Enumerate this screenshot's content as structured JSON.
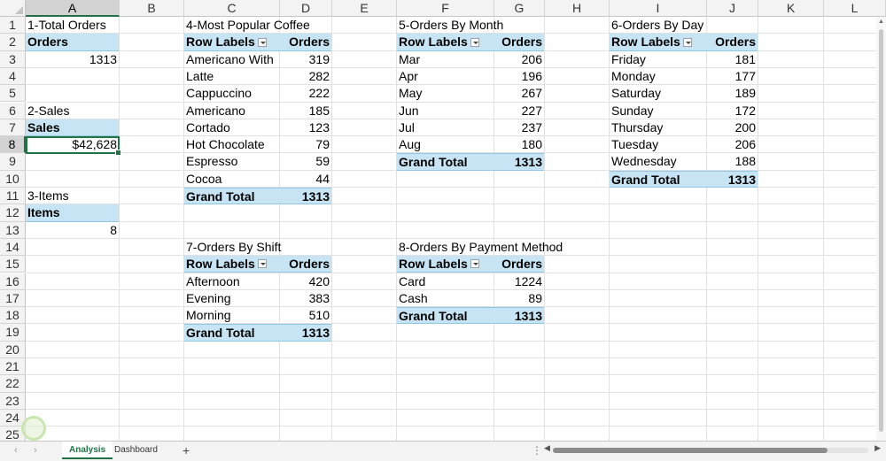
{
  "columns": [
    "A",
    "B",
    "C",
    "D",
    "E",
    "F",
    "G",
    "H",
    "I",
    "J",
    "K",
    "L"
  ],
  "rows": [
    "1",
    "2",
    "3",
    "4",
    "5",
    "6",
    "7",
    "8",
    "9",
    "10",
    "11",
    "12",
    "13",
    "14",
    "15",
    "16",
    "17",
    "18",
    "19",
    "20",
    "21",
    "22",
    "23",
    "24",
    "25"
  ],
  "selection": {
    "column": "A",
    "row": "8"
  },
  "total_orders": {
    "title": "1-Total Orders",
    "header": "Orders",
    "value": "1313"
  },
  "sales": {
    "title": "2-Sales",
    "header": "Sales",
    "value": "$42,628"
  },
  "items": {
    "title": "3-Items",
    "header": "Items",
    "value": "8"
  },
  "popular_coffee": {
    "title": "4-Most Popular Coffee",
    "row_labels": "Row Labels",
    "col_header": "Orders",
    "rows": [
      {
        "label": "Americano With",
        "value": "319"
      },
      {
        "label": "Latte",
        "value": "282"
      },
      {
        "label": "Cappuccino",
        "value": "222"
      },
      {
        "label": "Americano",
        "value": "185"
      },
      {
        "label": "Cortado",
        "value": "123"
      },
      {
        "label": "Hot Chocolate",
        "value": "79"
      },
      {
        "label": "Espresso",
        "value": "59"
      },
      {
        "label": "Cocoa",
        "value": "44"
      }
    ],
    "total_label": "Grand Total",
    "total": "1313"
  },
  "orders_by_month": {
    "title": "5-Orders By Month",
    "row_labels": "Row Labels",
    "col_header": "Orders",
    "rows": [
      {
        "label": "Mar",
        "value": "206"
      },
      {
        "label": "Apr",
        "value": "196"
      },
      {
        "label": "May",
        "value": "267"
      },
      {
        "label": "Jun",
        "value": "227"
      },
      {
        "label": "Jul",
        "value": "237"
      },
      {
        "label": "Aug",
        "value": "180"
      }
    ],
    "total_label": "Grand Total",
    "total": "1313"
  },
  "orders_by_day": {
    "title": "6-Orders By Day",
    "row_labels": "Row Labels",
    "col_header": "Orders",
    "rows": [
      {
        "label": "Friday",
        "value": "181"
      },
      {
        "label": "Monday",
        "value": "177"
      },
      {
        "label": "Saturday",
        "value": "189"
      },
      {
        "label": "Sunday",
        "value": "172"
      },
      {
        "label": "Thursday",
        "value": "200"
      },
      {
        "label": "Tuesday",
        "value": "206"
      },
      {
        "label": "Wednesday",
        "value": "188"
      }
    ],
    "total_label": "Grand Total",
    "total": "1313"
  },
  "orders_by_shift": {
    "title": "7-Orders By Shift",
    "row_labels": "Row Labels",
    "col_header": "Orders",
    "rows": [
      {
        "label": "Afternoon",
        "value": "420"
      },
      {
        "label": "Evening",
        "value": "383"
      },
      {
        "label": "Morning",
        "value": "510"
      }
    ],
    "total_label": "Grand Total",
    "total": "1313"
  },
  "orders_by_payment": {
    "title": "8-Orders By Payment Method",
    "row_labels": "Row Labels",
    "col_header": "Orders",
    "rows": [
      {
        "label": "Card",
        "value": "1224"
      },
      {
        "label": "Cash",
        "value": "89"
      }
    ],
    "total_label": "Grand Total",
    "total": "1313"
  },
  "sheet_tabs": [
    {
      "label": "Analysis",
      "active": true
    },
    {
      "label": "Dashboard",
      "active": false
    }
  ],
  "add_sheet_label": "+",
  "colors": {
    "pivot_fill": "#c6e4f3",
    "selection": "#217346",
    "grid": "#e1e1e1"
  }
}
